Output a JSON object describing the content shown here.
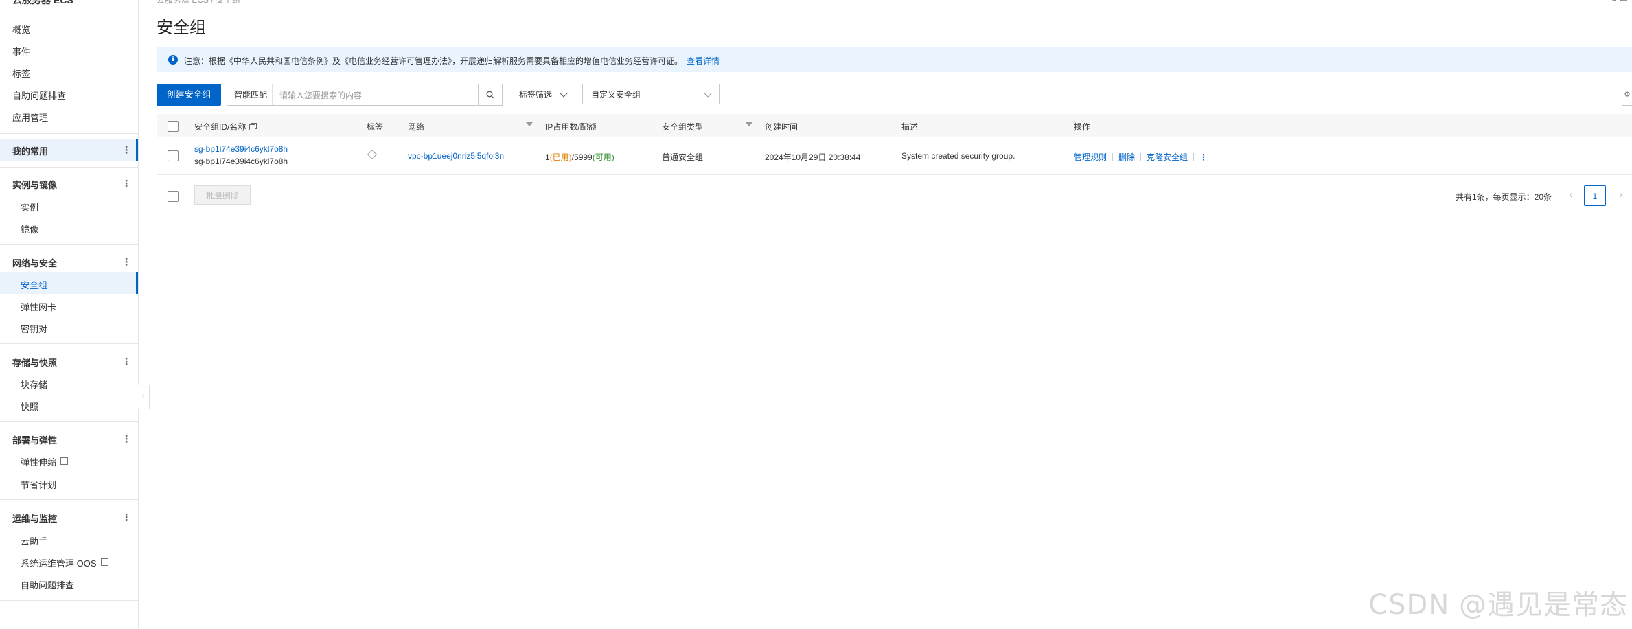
{
  "sidebar": {
    "top_title": "云服务器 ECS",
    "items_top": [
      "概览",
      "事件",
      "标签",
      "自助问题排查",
      "应用管理"
    ],
    "favorites": "我的常用",
    "groups": [
      {
        "title": "实例与镜像",
        "items": [
          "实例",
          "镜像"
        ]
      },
      {
        "title": "网络与安全",
        "items": [
          "安全组",
          "弹性网卡",
          "密钥对"
        ]
      },
      {
        "title": "存储与快照",
        "items": [
          "块存储",
          "快照"
        ]
      },
      {
        "title": "部署与弹性",
        "items": [
          "弹性伸缩",
          "节省计划"
        ]
      },
      {
        "title": "运维与监控",
        "items": [
          "云助手",
          "系统运维管理 OOS",
          "自助问题排查"
        ]
      }
    ],
    "active_item": "安全组"
  },
  "breadcrumb": "云服务器 ECS / 安全组",
  "page_title": "安全组",
  "notice": {
    "text": "注意：根据《中华人民共和国电信条例》及《电信业务经营许可管理办法》，开展递归解析服务需要具备相应的增值电信业务经营许可证。",
    "link": "查看详情"
  },
  "toolbar": {
    "create_button": "创建安全组",
    "search_mode": "智能匹配",
    "search_placeholder": "请输入您要搜索的内容",
    "tag_filter": "标签筛选",
    "custom_select": "自定义安全组"
  },
  "table": {
    "columns": [
      "安全组ID/名称",
      "标签",
      "网络",
      "IP占用数/配额",
      "安全组类型",
      "创建时间",
      "描述",
      "操作"
    ],
    "rows": [
      {
        "id": "sg-bp1i74e39i4c6ykl7o8h",
        "name": "sg-bp1i74e39i4c6ykl7o8h",
        "network": "vpc-bp1ueej0nriz5l5qfoi3n",
        "ip_used_count": "1",
        "ip_used_label": "(已用)",
        "ip_quota": "/5999",
        "ip_avail_label": "(可用)",
        "type": "普通安全组",
        "created": "2024年10月29日 20:38:44",
        "description": "System created security group.",
        "actions": [
          "管理规则",
          "删除",
          "克隆安全组"
        ]
      }
    ]
  },
  "footer": {
    "batch_delete": "批量删除",
    "summary": "共有1条，每页显示：20条",
    "current_page": "1"
  },
  "watermark": "CSDN @遇见是常态",
  "colors": {
    "primary": "#0064c8",
    "notice_bg": "#eaf4ff",
    "used": "#e07e00",
    "available": "#2a8a2a"
  }
}
